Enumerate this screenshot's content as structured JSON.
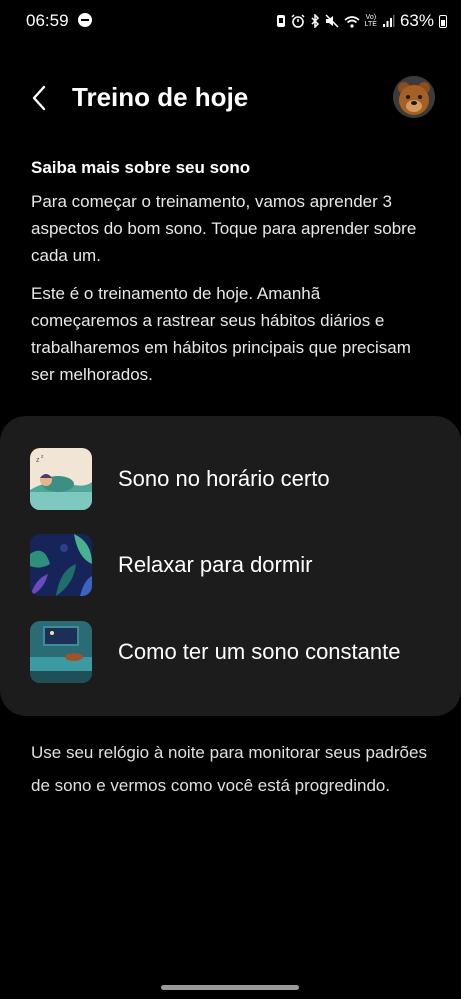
{
  "status_bar": {
    "time": "06:59",
    "battery_pct": "63%",
    "network": "LTE"
  },
  "header": {
    "title": "Treino de hoje"
  },
  "content": {
    "heading": "Saiba mais sobre seu sono",
    "intro": "Para começar o treinamento, vamos aprender 3 aspectos do bom sono. Toque para aprender sobre cada um.",
    "training_note": "Este é o treinamento de hoje. Amanhã começaremos a rastrear seus hábitos diários e trabalharemos em hábitos principais que precisam ser melhorados."
  },
  "topics": [
    {
      "label": "Sono no horário certo",
      "icon": "sleeping-person-illustration"
    },
    {
      "label": "Relaxar para dormir",
      "icon": "night-leaves-illustration"
    },
    {
      "label": "Como ter um sono constante",
      "icon": "bedroom-illustration"
    }
  ],
  "footer": {
    "text": "Use seu relógio à noite para monitorar seus padrões de sono e vermos como você está progredindo."
  }
}
